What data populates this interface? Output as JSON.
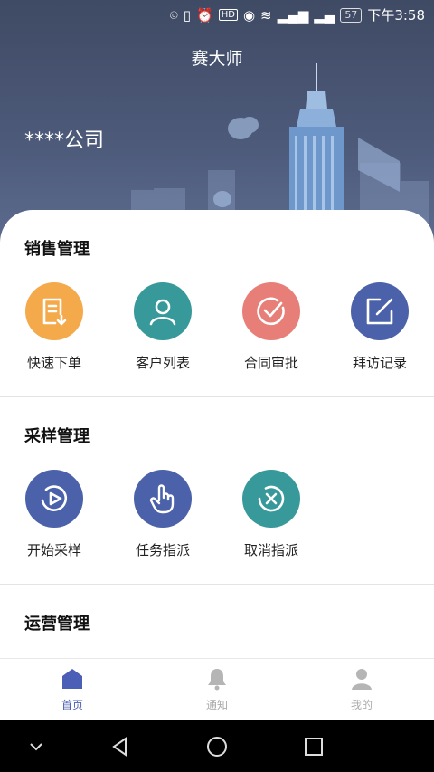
{
  "status": {
    "battery": "57",
    "time": "下午3:58"
  },
  "header": {
    "title": "赛大师",
    "company": "****公司"
  },
  "sections": [
    {
      "title": "销售管理",
      "items": [
        {
          "label": "快速下单",
          "icon": "order-icon",
          "color": "#f4a94a"
        },
        {
          "label": "客户列表",
          "icon": "user-icon",
          "color": "#37999a"
        },
        {
          "label": "合同审批",
          "icon": "check-icon",
          "color": "#e77f78"
        },
        {
          "label": "拜访记录",
          "icon": "edit-icon",
          "color": "#4b62aa"
        }
      ]
    },
    {
      "title": "采样管理",
      "items": [
        {
          "label": "开始采样",
          "icon": "play-icon",
          "color": "#4b62aa"
        },
        {
          "label": "任务指派",
          "icon": "hand-icon",
          "color": "#4b62aa"
        },
        {
          "label": "取消指派",
          "icon": "cancel-icon",
          "color": "#37999a"
        }
      ]
    },
    {
      "title": "运营管理",
      "items": []
    }
  ],
  "tabs": [
    {
      "label": "首页",
      "icon": "home-icon",
      "active": true
    },
    {
      "label": "通知",
      "icon": "bell-icon",
      "active": false
    },
    {
      "label": "我的",
      "icon": "profile-icon",
      "active": false
    }
  ],
  "colors": {
    "accent": "#4b5fb6",
    "hero": "#4a5675"
  }
}
